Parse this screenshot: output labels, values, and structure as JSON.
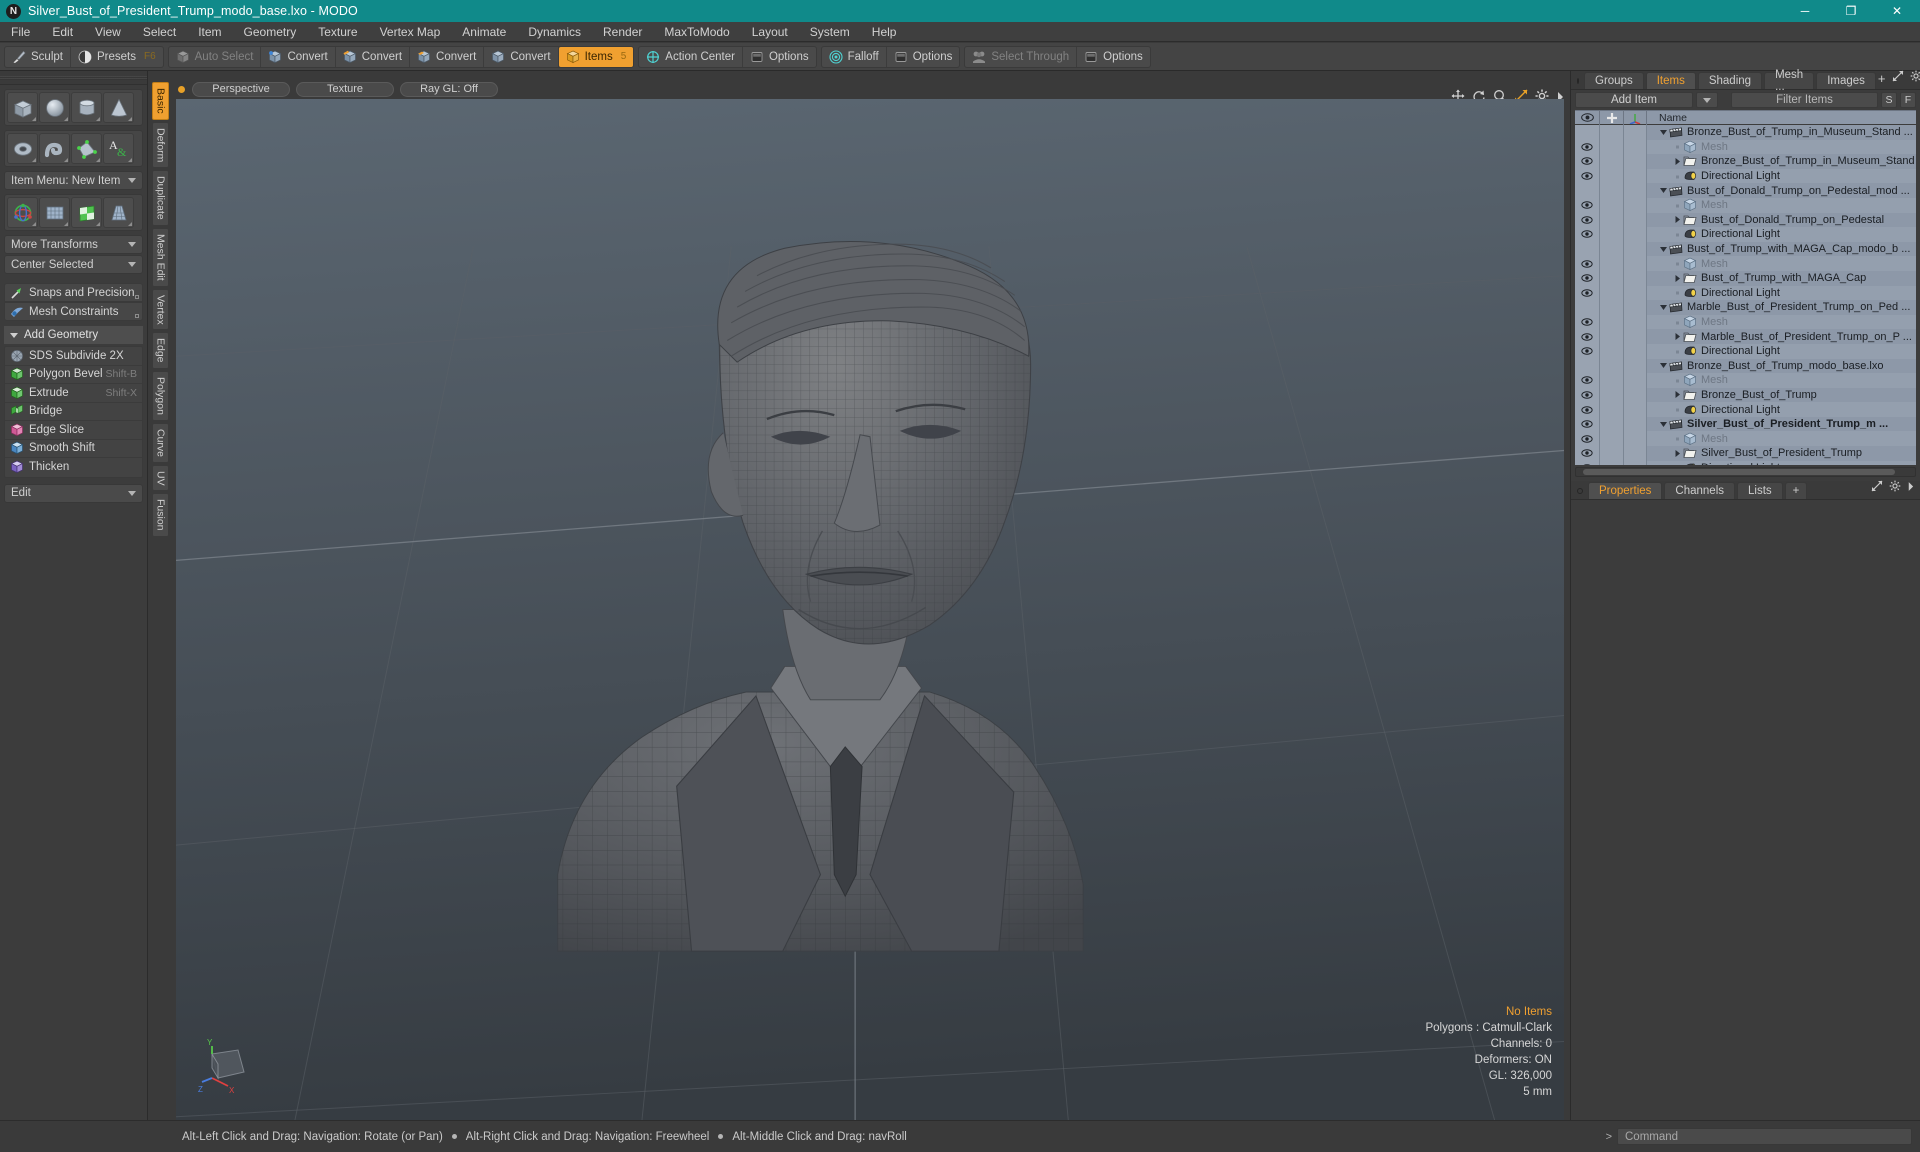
{
  "window": {
    "title": "Silver_Bust_of_President_Trump_modo_base.lxo - MODO",
    "app_icon": "modo-logo-icon",
    "minimize": "─",
    "maximize": "❐",
    "close": "✕",
    "titlebar_color": "#108a8a"
  },
  "menubar": {
    "items": [
      "File",
      "Edit",
      "View",
      "Select",
      "Item",
      "Geometry",
      "Texture",
      "Vertex Map",
      "Animate",
      "Dynamics",
      "Render",
      "MaxToModo",
      "Layout",
      "System",
      "Help"
    ]
  },
  "modebar": {
    "groups": [
      {
        "buttons": [
          {
            "label": "Sculpt",
            "icon": "sculpt-brush-icon",
            "state": "normal",
            "key": ""
          },
          {
            "label": "Presets",
            "icon": "presets-sphere-icon",
            "state": "normal",
            "key": "F6"
          }
        ]
      },
      {
        "buttons": [
          {
            "label": "Auto Select",
            "icon": "cube-grey-icon",
            "state": "dim",
            "key": ""
          },
          {
            "label": "Convert",
            "icon": "convert-vertex-icon",
            "state": "normal",
            "key": ""
          },
          {
            "label": "Convert",
            "icon": "convert-edge-icon",
            "state": "normal",
            "key": ""
          },
          {
            "label": "Convert",
            "icon": "convert-polygon-icon",
            "state": "normal",
            "key": ""
          },
          {
            "label": "Convert",
            "icon": "convert-item-icon",
            "state": "normal",
            "key": ""
          },
          {
            "label": "Items",
            "icon": "items-cube-icon",
            "state": "active",
            "key": "5"
          }
        ]
      },
      {
        "buttons": [
          {
            "label": "Action Center",
            "icon": "action-center-icon",
            "state": "normal",
            "key": ""
          },
          {
            "label": "Options",
            "icon": "options-icon",
            "state": "normal",
            "key": ""
          }
        ]
      },
      {
        "buttons": [
          {
            "label": "Falloff",
            "icon": "falloff-icon",
            "state": "normal",
            "key": ""
          },
          {
            "label": "Options",
            "icon": "options-icon",
            "state": "normal",
            "key": ""
          }
        ]
      },
      {
        "buttons": [
          {
            "label": "Select Through",
            "icon": "select-through-icon",
            "state": "dim",
            "key": ""
          },
          {
            "label": "Options",
            "icon": "options-icon",
            "state": "normal",
            "key": ""
          }
        ]
      }
    ]
  },
  "leftpanel": {
    "primitives_row1": [
      {
        "name": "cube-primitive"
      },
      {
        "name": "sphere-primitive"
      },
      {
        "name": "cylinder-primitive"
      },
      {
        "name": "cone-primitive"
      }
    ],
    "primitives_row2": [
      {
        "name": "torus-primitive"
      },
      {
        "name": "tube-primitive"
      },
      {
        "name": "vertex-polygon-primitive"
      },
      {
        "name": "text-primitive"
      }
    ],
    "item_menu": "Item Menu: New Item",
    "transform_tools": [
      {
        "name": "transform-gizmo-tool"
      },
      {
        "name": "bend-tool"
      },
      {
        "name": "checker-deform-tool"
      },
      {
        "name": "taper-tool"
      }
    ],
    "more_transforms": "More Transforms",
    "center_selected": "Center Selected",
    "snaps": "Snaps and Precision",
    "mesh_constraints": "Mesh Constraints",
    "add_geometry_header": "Add Geometry",
    "geometry_rows": [
      {
        "label": "SDS Subdivide 2X",
        "shortcut": "",
        "icon": "sds-subdivide-icon"
      },
      {
        "label": "Polygon Bevel",
        "shortcut": "Shift-B",
        "icon": "polygon-bevel-icon"
      },
      {
        "label": "Extrude",
        "shortcut": "Shift-X",
        "icon": "extrude-icon"
      },
      {
        "label": "Bridge",
        "shortcut": "",
        "icon": "bridge-icon"
      },
      {
        "label": "Edge Slice",
        "shortcut": "",
        "icon": "edge-slice-icon"
      },
      {
        "label": "Smooth Shift",
        "shortcut": "",
        "icon": "smooth-shift-icon"
      },
      {
        "label": "Thicken",
        "shortcut": "",
        "icon": "thicken-icon"
      }
    ],
    "edit_dropdown": "Edit"
  },
  "vertical_tabs": [
    {
      "label": "Basic",
      "active": true
    },
    {
      "label": "Deform",
      "active": false
    },
    {
      "label": "Duplicate",
      "active": false
    },
    {
      "label": "Mesh Edit",
      "active": false
    },
    {
      "label": "Vertex",
      "active": false
    },
    {
      "label": "Edge",
      "active": false
    },
    {
      "label": "Polygon",
      "active": false
    },
    {
      "label": "Curve",
      "active": false
    },
    {
      "label": "UV",
      "active": false
    },
    {
      "label": "Fusion",
      "active": false
    }
  ],
  "viewport": {
    "pills": [
      "Perspective",
      "Texture",
      "Ray GL: Off"
    ],
    "tool_icons": [
      "move-icon",
      "rotate-icon",
      "zoom-icon",
      "fit-icon",
      "gear-icon",
      "chevron-right-icon"
    ],
    "stats": {
      "no_items": "No Items",
      "polygons": "Polygons : Catmull-Clark",
      "channels": "Channels: 0",
      "deformers": "Deformers: ON",
      "gl": "GL: 326,000",
      "scale": "5 mm"
    },
    "axis_labels": {
      "y": "Y",
      "x": "X",
      "z": "Z"
    },
    "accent_color": "#f0a030"
  },
  "rightpanel": {
    "tabs": [
      {
        "label": "Groups",
        "active": false
      },
      {
        "label": "Items",
        "active": true
      },
      {
        "label": "Shading",
        "active": false
      },
      {
        "label": "Mesh ...",
        "active": false
      },
      {
        "label": "Images",
        "active": false
      }
    ],
    "tab_add": "+",
    "tab_tools": [
      "expand-icon",
      "gear-icon",
      "chevron-right-icon"
    ],
    "add_item": "Add Item",
    "filter_placeholder": "Filter Items",
    "btn_s": "S",
    "btn_f": "F",
    "tree_columns": {
      "eye": "visibility-eye-icon",
      "lock": "lock-icon",
      "axis": "axis-icon",
      "name": "Name"
    },
    "tree_rows": [
      {
        "indent": 0,
        "twirl": "down",
        "icon": "scene-clapper-icon",
        "label": "Bronze_Bust_of_Trump_in_Museum_Stand ...",
        "eye": false,
        "dim": false,
        "bold": false
      },
      {
        "indent": 1,
        "twirl": "none",
        "icon": "mesh-cube-icon",
        "label": "Mesh",
        "eye": true,
        "dim": true,
        "bold": false
      },
      {
        "indent": 1,
        "twirl": "right",
        "icon": "mesh-folder-icon",
        "label": "Bronze_Bust_of_Trump_in_Museum_Stand",
        "eye": true,
        "dim": false,
        "bold": false
      },
      {
        "indent": 1,
        "twirl": "none",
        "icon": "directional-light-icon",
        "label": "Directional Light",
        "eye": true,
        "dim": false,
        "bold": false
      },
      {
        "indent": 0,
        "twirl": "down",
        "icon": "scene-clapper-icon",
        "label": "Bust_of_Donald_Trump_on_Pedestal_mod ...",
        "eye": false,
        "dim": false,
        "bold": false
      },
      {
        "indent": 1,
        "twirl": "none",
        "icon": "mesh-cube-icon",
        "label": "Mesh",
        "eye": true,
        "dim": true,
        "bold": false
      },
      {
        "indent": 1,
        "twirl": "right",
        "icon": "mesh-folder-icon",
        "label": "Bust_of_Donald_Trump_on_Pedestal",
        "eye": true,
        "dim": false,
        "bold": false
      },
      {
        "indent": 1,
        "twirl": "none",
        "icon": "directional-light-icon",
        "label": "Directional Light",
        "eye": true,
        "dim": false,
        "bold": false
      },
      {
        "indent": 0,
        "twirl": "down",
        "icon": "scene-clapper-icon",
        "label": "Bust_of_Trump_with_MAGA_Cap_modo_b ...",
        "eye": false,
        "dim": false,
        "bold": false
      },
      {
        "indent": 1,
        "twirl": "none",
        "icon": "mesh-cube-icon",
        "label": "Mesh",
        "eye": true,
        "dim": true,
        "bold": false
      },
      {
        "indent": 1,
        "twirl": "right",
        "icon": "mesh-folder-icon",
        "label": "Bust_of_Trump_with_MAGA_Cap",
        "eye": true,
        "dim": false,
        "bold": false
      },
      {
        "indent": 1,
        "twirl": "none",
        "icon": "directional-light-icon",
        "label": "Directional Light",
        "eye": true,
        "dim": false,
        "bold": false
      },
      {
        "indent": 0,
        "twirl": "down",
        "icon": "scene-clapper-icon",
        "label": "Marble_Bust_of_President_Trump_on_Ped ...",
        "eye": false,
        "dim": false,
        "bold": false
      },
      {
        "indent": 1,
        "twirl": "none",
        "icon": "mesh-cube-icon",
        "label": "Mesh",
        "eye": true,
        "dim": true,
        "bold": false
      },
      {
        "indent": 1,
        "twirl": "right",
        "icon": "mesh-folder-icon",
        "label": "Marble_Bust_of_President_Trump_on_P ...",
        "eye": true,
        "dim": false,
        "bold": false
      },
      {
        "indent": 1,
        "twirl": "none",
        "icon": "directional-light-icon",
        "label": "Directional Light",
        "eye": true,
        "dim": false,
        "bold": false
      },
      {
        "indent": 0,
        "twirl": "down",
        "icon": "scene-clapper-icon",
        "label": "Bronze_Bust_of_Trump_modo_base.lxo",
        "eye": false,
        "dim": false,
        "bold": false
      },
      {
        "indent": 1,
        "twirl": "none",
        "icon": "mesh-cube-icon",
        "label": "Mesh",
        "eye": true,
        "dim": true,
        "bold": false
      },
      {
        "indent": 1,
        "twirl": "right",
        "icon": "mesh-folder-icon",
        "label": "Bronze_Bust_of_Trump",
        "eye": true,
        "dim": false,
        "bold": false
      },
      {
        "indent": 1,
        "twirl": "none",
        "icon": "directional-light-icon",
        "label": "Directional Light",
        "eye": true,
        "dim": false,
        "bold": false
      },
      {
        "indent": 0,
        "twirl": "down",
        "icon": "scene-clapper-icon",
        "label": "Silver_Bust_of_President_Trump_m ...",
        "eye": true,
        "dim": false,
        "bold": true
      },
      {
        "indent": 1,
        "twirl": "none",
        "icon": "mesh-cube-icon",
        "label": "Mesh",
        "eye": true,
        "dim": true,
        "bold": false
      },
      {
        "indent": 1,
        "twirl": "right",
        "icon": "mesh-folder-icon",
        "label": "Silver_Bust_of_President_Trump",
        "eye": true,
        "dim": false,
        "bold": false
      },
      {
        "indent": 1,
        "twirl": "none",
        "icon": "directional-light-icon",
        "label": "Directional Light",
        "eye": true,
        "dim": false,
        "bold": false
      }
    ],
    "lower_tabs": [
      {
        "label": "Properties",
        "active": true
      },
      {
        "label": "Channels",
        "active": false
      },
      {
        "label": "Lists",
        "active": false
      }
    ],
    "lower_tab_add": "+"
  },
  "statusbar": {
    "hints": [
      "Alt-Left Click and Drag: Navigation: Rotate (or Pan)",
      "Alt-Right Click and Drag: Navigation: Freewheel",
      "Alt-Middle Click and Drag: navRoll"
    ],
    "command_placeholder": "Command",
    "command_prefix": ">"
  }
}
